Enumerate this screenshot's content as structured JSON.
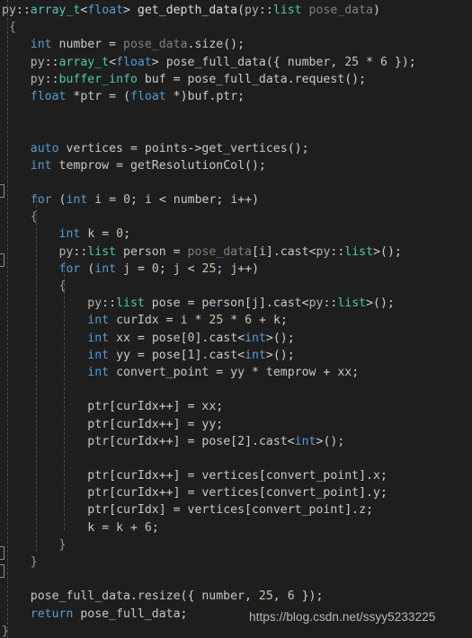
{
  "editor": {
    "background_color": "#1e1e1e",
    "language": "C++",
    "colors": {
      "keyword": "#569cd6",
      "type": "#4ec9b0",
      "number": "#b5cea8",
      "identifier": "#c8c8c8",
      "dimmed": "#808080",
      "function": "#dcdcdc",
      "brace": "#9a9a9a",
      "background": "#1e1e1e",
      "watermark": "#b9b9b9"
    }
  },
  "watermark": {
    "text": "https://blog.csdn.net/ssyy5233225"
  },
  "code": {
    "lines": [
      {
        "n": 1,
        "text": "py::array_t<float> get_depth_data(py::list pose_data)"
      },
      {
        "n": 2,
        "text": "{"
      },
      {
        "n": 3,
        "text": "    int number = pose_data.size();"
      },
      {
        "n": 4,
        "text": "    py::array_t<float> pose_full_data({ number, 25 * 6 });"
      },
      {
        "n": 5,
        "text": "    py::buffer_info buf = pose_full_data.request();"
      },
      {
        "n": 6,
        "text": "    float *ptr = (float *)buf.ptr;"
      },
      {
        "n": 7,
        "text": ""
      },
      {
        "n": 8,
        "text": ""
      },
      {
        "n": 9,
        "text": "    auto vertices = points->get_vertices();"
      },
      {
        "n": 10,
        "text": "    int temprow = getResolutionCol();"
      },
      {
        "n": 11,
        "text": ""
      },
      {
        "n": 12,
        "text": "    for (int i = 0; i < number; i++)"
      },
      {
        "n": 13,
        "text": "    {"
      },
      {
        "n": 14,
        "text": "        int k = 0;"
      },
      {
        "n": 15,
        "text": "        py::list person = pose_data[i].cast<py::list>();"
      },
      {
        "n": 16,
        "text": "        for (int j = 0; j < 25; j++)"
      },
      {
        "n": 17,
        "text": "        {"
      },
      {
        "n": 18,
        "text": "            py::list pose = person[j].cast<py::list>();"
      },
      {
        "n": 19,
        "text": "            int curIdx = i * 25 * 6 + k;"
      },
      {
        "n": 20,
        "text": "            int xx = pose[0].cast<int>();"
      },
      {
        "n": 21,
        "text": "            int yy = pose[1].cast<int>();"
      },
      {
        "n": 22,
        "text": "            int convert_point = yy * temprow + xx;"
      },
      {
        "n": 23,
        "text": ""
      },
      {
        "n": 24,
        "text": "            ptr[curIdx++] = xx;"
      },
      {
        "n": 25,
        "text": "            ptr[curIdx++] = yy;"
      },
      {
        "n": 26,
        "text": "            ptr[curIdx++] = pose[2].cast<int>();"
      },
      {
        "n": 27,
        "text": ""
      },
      {
        "n": 28,
        "text": "            ptr[curIdx++] = vertices[convert_point].x;"
      },
      {
        "n": 29,
        "text": "            ptr[curIdx++] = vertices[convert_point].y;"
      },
      {
        "n": 30,
        "text": "            ptr[curIdx] = vertices[convert_point].z;"
      },
      {
        "n": 31,
        "text": "            k = k + 6;"
      },
      {
        "n": 32,
        "text": "        }"
      },
      {
        "n": 33,
        "text": "    }"
      },
      {
        "n": 34,
        "text": ""
      },
      {
        "n": 35,
        "text": "    pose_full_data.resize({ number, 25, 6 });"
      },
      {
        "n": 36,
        "text": "    return pose_full_data;"
      },
      {
        "n": 37,
        "text": "}"
      }
    ]
  }
}
